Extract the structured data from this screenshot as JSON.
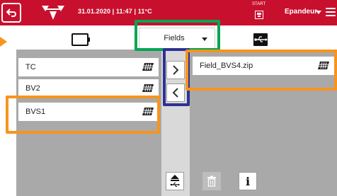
{
  "header": {
    "datetime_text": "31.01.2020 | 11:47 | 11°C",
    "start_label": "START",
    "profile_label": "Epandeur",
    "icons": {
      "back": "back-arrow-icon",
      "logo": "triple-triangle-logo",
      "start": "save-icon",
      "menu": "hamburger-menu-icon"
    },
    "colors": {
      "bar": "#c8102e",
      "foreground": "#ffffff"
    }
  },
  "source_bar": {
    "dropdown": {
      "selected": "Fields"
    },
    "left_source_icon": "tablet-icon",
    "right_source_icon": "usb-icon"
  },
  "left_list": {
    "items": [
      {
        "label": "TC",
        "icon": "field-icon"
      },
      {
        "label": "BV2",
        "icon": "field-icon"
      },
      {
        "label": "BVS1",
        "icon": "field-icon"
      }
    ]
  },
  "right_list": {
    "items": [
      {
        "label": "Field_BVS4.zip",
        "icon": "field-icon"
      }
    ]
  },
  "transfer": {
    "to_right_icon": "chevron-right-icon",
    "to_left_icon": "chevron-left-icon"
  },
  "bottom_bar": {
    "eject_icon": "usb-eject-icon",
    "delete_icon": "trash-icon",
    "info_glyph": "i"
  },
  "highlight_colors": {
    "green": "#00a651",
    "blue": "#2e3192",
    "orange": "#f7941d"
  }
}
